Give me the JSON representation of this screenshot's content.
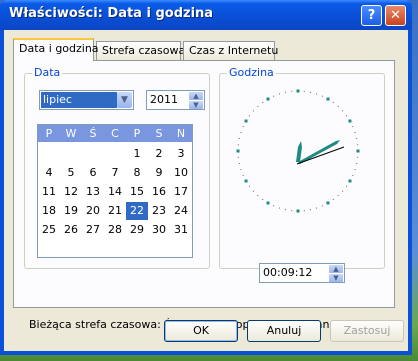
{
  "window": {
    "title": "Właściwości: Data i godzina",
    "help_label": "?",
    "close_label": "✕"
  },
  "tabs": [
    {
      "label": "Data i godzina",
      "active": true
    },
    {
      "label": "Strefa czasowa",
      "active": false
    },
    {
      "label": "Czas z Internetu",
      "active": false
    }
  ],
  "date_group": {
    "label": "Data",
    "month": "lipiec",
    "year": "2011",
    "weekdays": [
      "P",
      "W",
      "Ś",
      "C",
      "P",
      "S",
      "N"
    ],
    "weeks": [
      [
        "",
        "",
        "",
        "",
        "1",
        "2",
        "3"
      ],
      [
        "4",
        "5",
        "6",
        "7",
        "8",
        "9",
        "10"
      ],
      [
        "11",
        "12",
        "13",
        "14",
        "15",
        "16",
        "17"
      ],
      [
        "18",
        "19",
        "20",
        "21",
        "22",
        "23",
        "24"
      ],
      [
        "25",
        "26",
        "27",
        "28",
        "29",
        "30",
        "31"
      ]
    ],
    "selected_day": "22"
  },
  "time_group": {
    "label": "Godzina",
    "time": "00:09:12"
  },
  "timezone_text": "Bieżąca strefa czasowa: Środkowoeuropejski czas stand.",
  "buttons": {
    "ok": "OK",
    "cancel": "Anuluj",
    "apply": "Zastosuj"
  },
  "icons": {
    "help": "help-icon",
    "close": "close-icon"
  },
  "colors": {
    "title_bar": "#0a4fd6",
    "selection": "#316ac5",
    "calendar_header": "#7a96df",
    "clock_hand": "#1f8a82"
  }
}
